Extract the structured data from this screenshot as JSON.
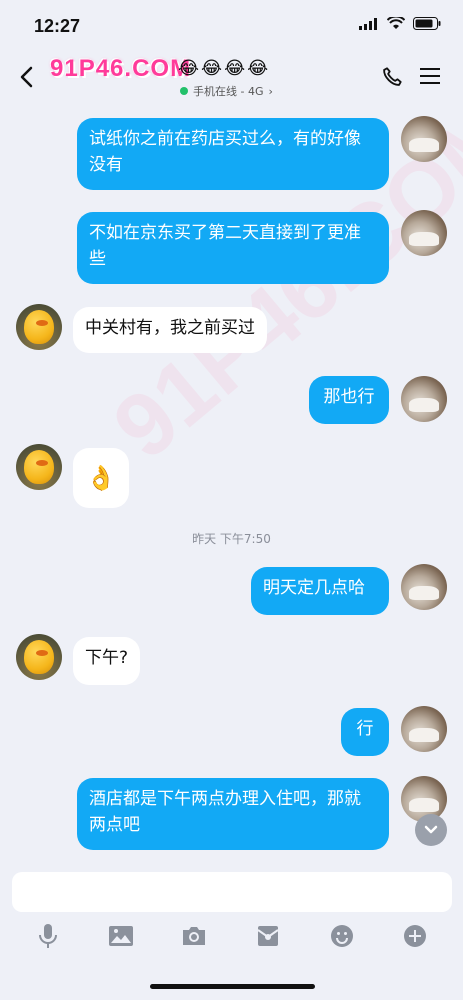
{
  "status": {
    "time": "12:27"
  },
  "header": {
    "title": "91P46.COM",
    "emojis": "😂😂😂😂",
    "status_text": "手机在线 - 4G",
    "status_chevron": "›"
  },
  "messages": [
    {
      "side": "right",
      "text": "试纸你之前在药店买过么，有的好像没有"
    },
    {
      "side": "right",
      "text": "不如在京东买了第二天直接到了更准些"
    },
    {
      "side": "left",
      "text": "中关村有，我之前买过"
    },
    {
      "side": "right",
      "text": "那也行"
    },
    {
      "side": "left",
      "text": "👌"
    },
    {
      "type": "timestamp",
      "text": "昨天 下午7:50"
    },
    {
      "side": "right",
      "text": "明天定几点哈"
    },
    {
      "side": "left",
      "text": "下午?"
    },
    {
      "side": "right",
      "text": "行"
    },
    {
      "side": "right",
      "text": "酒店都是下午两点办理入住吧，那就两点吧"
    }
  ],
  "watermark_text": "91P46.COM",
  "input": {
    "placeholder": ""
  },
  "toolbar": [
    "mic-icon",
    "image-icon",
    "camera-icon",
    "red-packet-icon",
    "emoji-icon",
    "plus-icon"
  ],
  "colors": {
    "bubble_right": "#12a9f5",
    "bubble_left": "#ffffff",
    "background": "#eef0f7",
    "online": "#22c06a"
  }
}
